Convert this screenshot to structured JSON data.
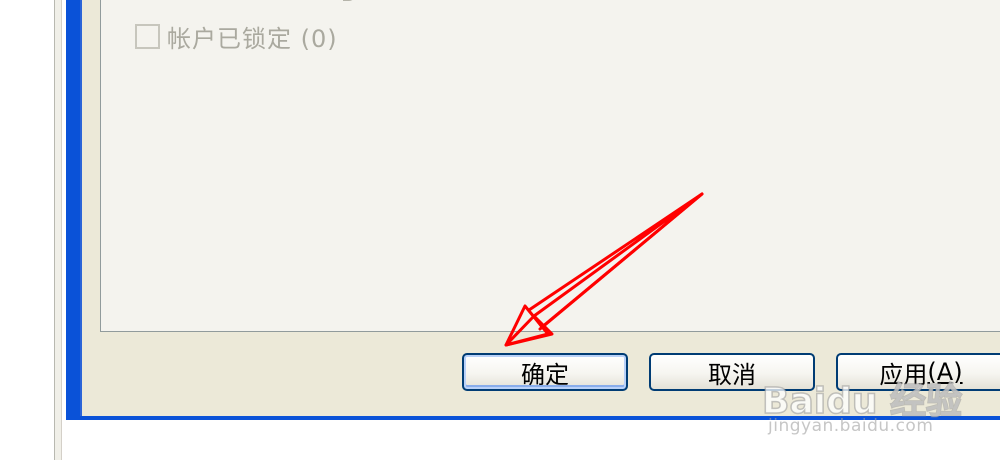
{
  "options": {
    "account_locked": {
      "label": "帐户已锁定 (0)",
      "checked": false,
      "enabled": false
    }
  },
  "buttons": {
    "ok_label": "确定",
    "cancel_label": "取消",
    "apply_label": "应用",
    "apply_mnemonic": "(A)"
  },
  "watermark": {
    "logo": "Baidu 经验",
    "sub": "jingyan.baidu.com"
  },
  "colors": {
    "title_blue": "#0a52d8",
    "annotation_red": "#ff0000",
    "dialog_face": "#ece9d8",
    "panel_face": "#f4f3ee",
    "disabled_text": "#aaa99f"
  },
  "icons": {
    "annotation": "red-arrow-icon"
  }
}
